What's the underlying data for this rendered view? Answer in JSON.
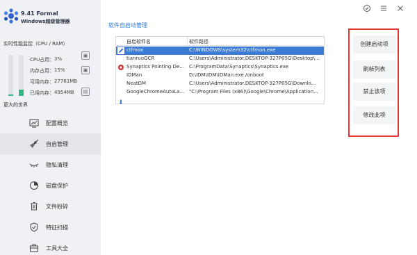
{
  "app": {
    "version_line": "9.41 Formal",
    "name": "Windows超级管理器"
  },
  "window_controls": {
    "feedback_icon": "check-circle-icon",
    "menu_icon": "menu-icon",
    "close_icon": "close-icon"
  },
  "monitor": {
    "title": "实时性能监控（CPU / RAM）",
    "cpu_label": "CPU占用：",
    "cpu_value": "3%",
    "cpu_fraction": 0.03,
    "mem_label": "内存占用：",
    "mem_value": "15%",
    "mem_fraction": 0.15,
    "avail_label": "可用内存：",
    "avail_value": "27761MB",
    "used_label": "已用内存：",
    "used_value": "4954MB"
  },
  "sidebar": {
    "section_label": "更大的世界",
    "items": [
      {
        "label": "配置概览",
        "icon": "chart-icon"
      },
      {
        "label": "自启管理",
        "icon": "rocket-icon",
        "active": true
      },
      {
        "label": "隐私清理",
        "icon": "eye-icon"
      },
      {
        "label": "磁盘保护",
        "icon": "pie-icon"
      },
      {
        "label": "文件粉碎",
        "icon": "trash-icon"
      },
      {
        "label": "特征扫描",
        "icon": "shield-icon"
      },
      {
        "label": "工具大全",
        "icon": "toolbox-icon"
      }
    ]
  },
  "main": {
    "section_title": "软件自启动管理",
    "table": {
      "headers": [
        "自启软件名",
        "软件路径"
      ],
      "rows": [
        {
          "name": "ctfmon",
          "path": "C:\\WINDOWS\\system32\\ctfmon.exe",
          "selected": true
        },
        {
          "name": "tianruoOCR",
          "path": "C:\\Users\\Administrator.DESKTOP-327P05G\\Desktop\\..."
        },
        {
          "name": "Synaptics Pointing De...",
          "path": "C:\\ProgramData\\Synaptics\\Synaptics.exe"
        },
        {
          "name": "IDMan",
          "path": "D:\\IDM\\IDM\\IDMan.exe /onboot"
        },
        {
          "name": "NeatDM",
          "path": "C:\\Users\\Administrator.DESKTOP-327P05G\\Downlo..."
        },
        {
          "name": "GoogleChromeAutoLa...",
          "path": "\"C:\\Program Files (x86)\\Google\\Chrome\\Application..."
        }
      ]
    },
    "actions": [
      "创建启动项",
      "刷新列表",
      "禁止该项",
      "修改此项"
    ]
  },
  "colors": {
    "accent": "#2b7de9",
    "selection": "#3b7bd4",
    "gauge_fill": "#31b783",
    "highlight_border": "#e53935"
  }
}
